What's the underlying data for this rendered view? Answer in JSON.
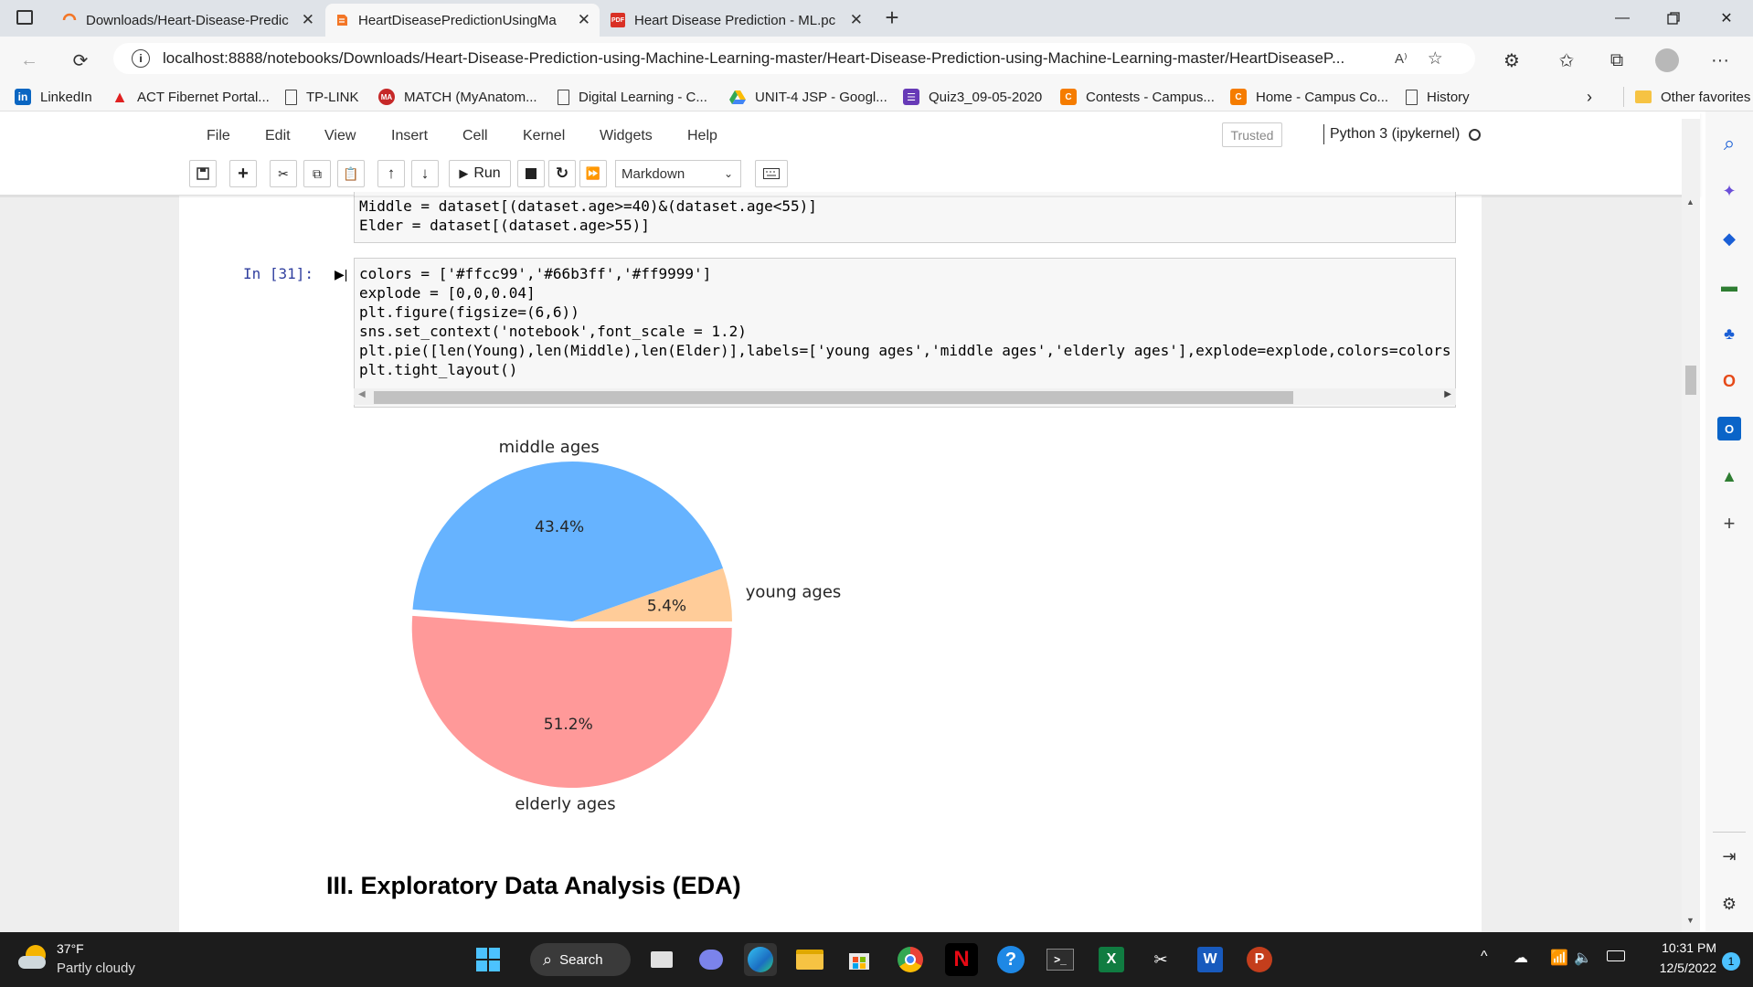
{
  "browser": {
    "tabs": [
      {
        "title": "Downloads/Heart-Disease-Predic",
        "active": false
      },
      {
        "title": "HeartDiseasePredictionUsingMa",
        "active": true
      },
      {
        "title": "Heart Disease Prediction - ML.pc",
        "active": false
      }
    ],
    "new_tab": "+",
    "url": "localhost:8888/notebooks/Downloads/Heart-Disease-Prediction-using-Machine-Learning-master/Heart-Disease-Prediction-using-Machine-Learning-master/HeartDiseaseP...",
    "bookmarks": [
      {
        "label": "LinkedIn",
        "icon": "linkedin-icon"
      },
      {
        "label": "ACT Fibernet Portal...",
        "icon": "act-icon"
      },
      {
        "label": "TP-LINK",
        "icon": "page-icon"
      },
      {
        "label": "MATCH (MyAnatom...",
        "icon": "match-icon"
      },
      {
        "label": "Digital Learning - C...",
        "icon": "page-icon"
      },
      {
        "label": "UNIT-4 JSP - Googl...",
        "icon": "drive-icon"
      },
      {
        "label": "Quiz3_09-05-2020",
        "icon": "forms-icon"
      },
      {
        "label": "Contests - Campus...",
        "icon": "campus-icon"
      },
      {
        "label": "Home - Campus Co...",
        "icon": "campus-icon"
      },
      {
        "label": "History",
        "icon": "page-icon"
      }
    ],
    "other_favorites": "Other favorites"
  },
  "jupyter": {
    "menu": [
      "File",
      "Edit",
      "View",
      "Insert",
      "Cell",
      "Kernel",
      "Widgets",
      "Help"
    ],
    "trusted": "Trusted",
    "kernel": "Python 3 (ipykernel)",
    "run_label": "Run",
    "cell_type": "Markdown"
  },
  "cells": {
    "prev_code": [
      "Middle = dataset[(dataset.age>=40)&(dataset.age<55)]",
      "Elder = dataset[(dataset.age>55)]"
    ],
    "prompt": "In [31]:",
    "code": [
      "colors = ['#ffcc99','#66b3ff','#ff9999']",
      "explode = [0,0,0.04]",
      "plt.figure(figsize=(6,6))",
      "sns.set_context('notebook',font_scale = 1.2)",
      "plt.pie([len(Young),len(Middle),len(Elder)],labels=['young ages','middle ages','elderly ages'],explode=explode,colors=colors,",
      "plt.tight_layout()"
    ],
    "heading": "III. Exploratory Data Analysis (EDA)"
  },
  "chart_data": {
    "type": "pie",
    "categories": [
      "young ages",
      "middle ages",
      "elderly ages"
    ],
    "values": [
      5.4,
      43.4,
      51.2
    ],
    "value_labels": [
      "5.4%",
      "43.4%",
      "51.2%"
    ],
    "colors": [
      "#ffcc99",
      "#66b3ff",
      "#ff9999"
    ],
    "explode": [
      0,
      0,
      0.04
    ]
  },
  "taskbar": {
    "weather_temp": "37°F",
    "weather_desc": "Partly cloudy",
    "search": "Search",
    "time": "10:31 PM",
    "date": "12/5/2022",
    "notif_count": "1"
  }
}
